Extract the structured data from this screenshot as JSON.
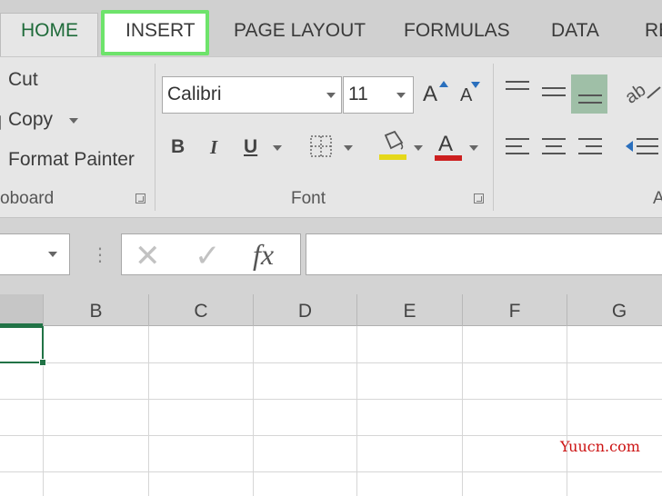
{
  "tabs": {
    "home": "HOME",
    "insert": "INSERT",
    "page_layout": "PAGE LAYOUT",
    "formulas": "FORMULAS",
    "data": "DATA",
    "review_partial": "RE"
  },
  "clipboard": {
    "cut": "Cut",
    "copy": "Copy",
    "format_painter": "Format Painter",
    "group_label": "oboard"
  },
  "font": {
    "font_name": "Calibri",
    "font_size": "11",
    "grow_glyph": "A",
    "shrink_glyph": "A",
    "bold": "B",
    "italic": "I",
    "underline": "U",
    "font_color_glyph": "A",
    "group_label": "Font"
  },
  "alignment": {
    "group_label_partial": "A"
  },
  "formula_bar": {
    "cancel_glyph": "✕",
    "enter_glyph": "✓",
    "fx": "fx",
    "more_glyph": "⋮"
  },
  "columns": [
    "B",
    "C",
    "D",
    "E",
    "F",
    "G"
  ],
  "watermark": "Yuucn.com",
  "colors": {
    "highlight_border": "#6ee36b",
    "selection": "#217346",
    "home_tab_text": "#1f6b3a",
    "fill_yellow": "#e5d81a",
    "font_red": "#cc1f1f"
  }
}
